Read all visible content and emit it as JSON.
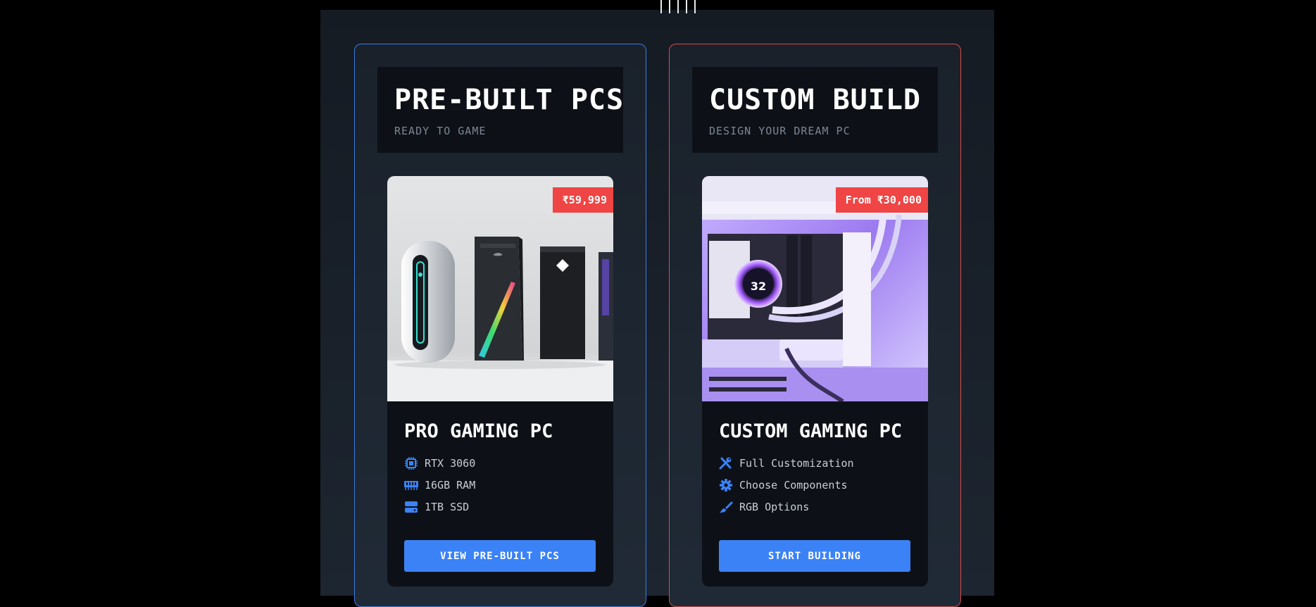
{
  "cards": [
    {
      "header_title": "PRE-BUILT PCS",
      "header_subtitle": "READY TO GAME",
      "price": "₹59,999",
      "product_name": "PRO GAMING PC",
      "features": [
        {
          "icon": "cpu-icon",
          "label": "RTX 3060"
        },
        {
          "icon": "memory-icon",
          "label": "16GB RAM"
        },
        {
          "icon": "hard-drive-icon",
          "label": "1TB SSD"
        }
      ],
      "button_label": "VIEW PRE-BUILT PCS",
      "border_color": "#3d7be0"
    },
    {
      "header_title": "CUSTOM BUILD",
      "header_subtitle": "DESIGN YOUR DREAM PC",
      "price": "From ₹30,000",
      "product_name": "CUSTOM GAMING PC",
      "features": [
        {
          "icon": "tools-icon",
          "label": "Full Customization"
        },
        {
          "icon": "gear-icon",
          "label": "Choose Components"
        },
        {
          "icon": "paint-brush-icon",
          "label": "RGB Options"
        }
      ],
      "button_label": "START BUILDING",
      "border_color": "#d74a4a"
    }
  ],
  "colors": {
    "accent_blue": "#3b82f6",
    "price_red": "#ef4545",
    "background": "#000000",
    "panel": "#0d1117"
  }
}
